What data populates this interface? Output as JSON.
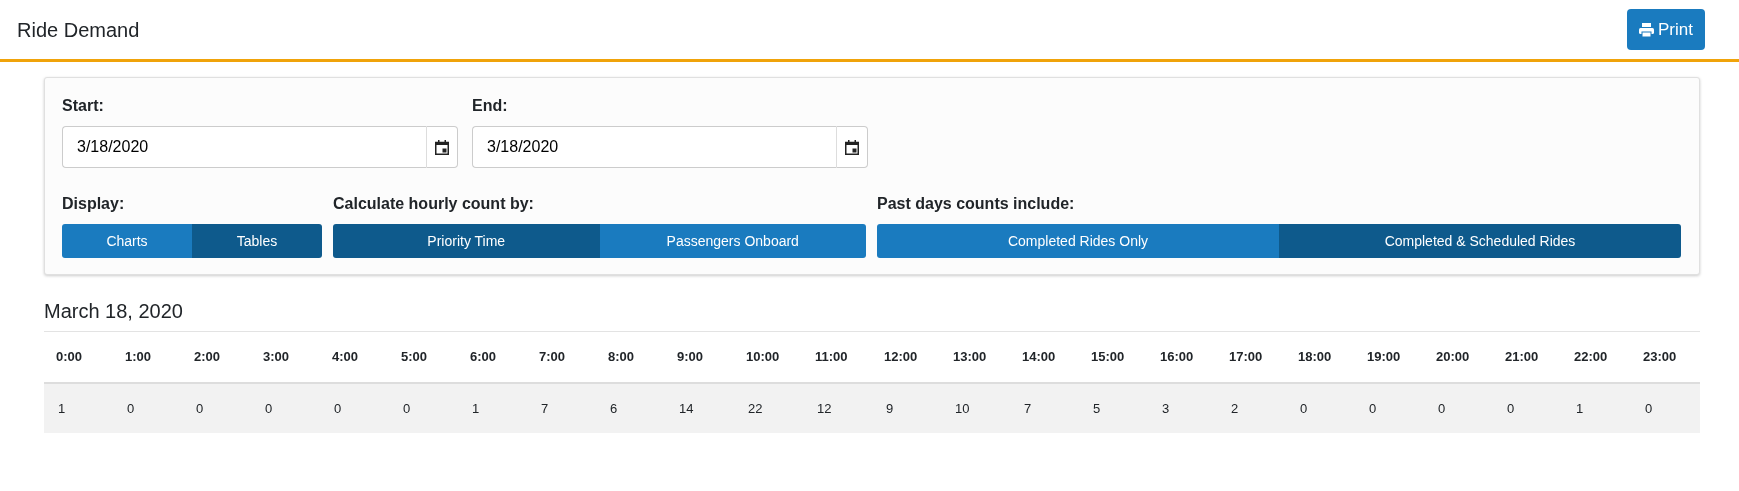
{
  "header": {
    "title": "Ride Demand",
    "print_button": "Print"
  },
  "filters": {
    "start": {
      "label": "Start:",
      "value": "3/18/2020"
    },
    "end": {
      "label": "End:",
      "value": "3/18/2020"
    },
    "groups": [
      {
        "label": "Display:",
        "options": [
          {
            "label": "Charts",
            "selected": false
          },
          {
            "label": "Tables",
            "selected": true
          }
        ]
      },
      {
        "label": "Calculate hourly count by:",
        "options": [
          {
            "label": "Priority Time",
            "selected": true
          },
          {
            "label": "Passengers Onboard",
            "selected": false
          }
        ]
      },
      {
        "label": "Past days counts include:",
        "options": [
          {
            "label": "Completed Rides Only",
            "selected": false
          },
          {
            "label": "Completed & Scheduled Rides",
            "selected": true
          }
        ]
      }
    ]
  },
  "report": {
    "date": "March 18, 2020",
    "table": {
      "columns": [
        "0:00",
        "1:00",
        "2:00",
        "3:00",
        "4:00",
        "5:00",
        "6:00",
        "7:00",
        "8:00",
        "9:00",
        "10:00",
        "11:00",
        "12:00",
        "13:00",
        "14:00",
        "15:00",
        "16:00",
        "17:00",
        "18:00",
        "19:00",
        "20:00",
        "21:00",
        "22:00",
        "23:00"
      ],
      "rows": [
        [
          "1",
          "0",
          "0",
          "0",
          "0",
          "0",
          "1",
          "7",
          "6",
          "14",
          "22",
          "12",
          "9",
          "10",
          "7",
          "5",
          "3",
          "2",
          "0",
          "0",
          "0",
          "0",
          "1",
          "0"
        ]
      ]
    }
  }
}
